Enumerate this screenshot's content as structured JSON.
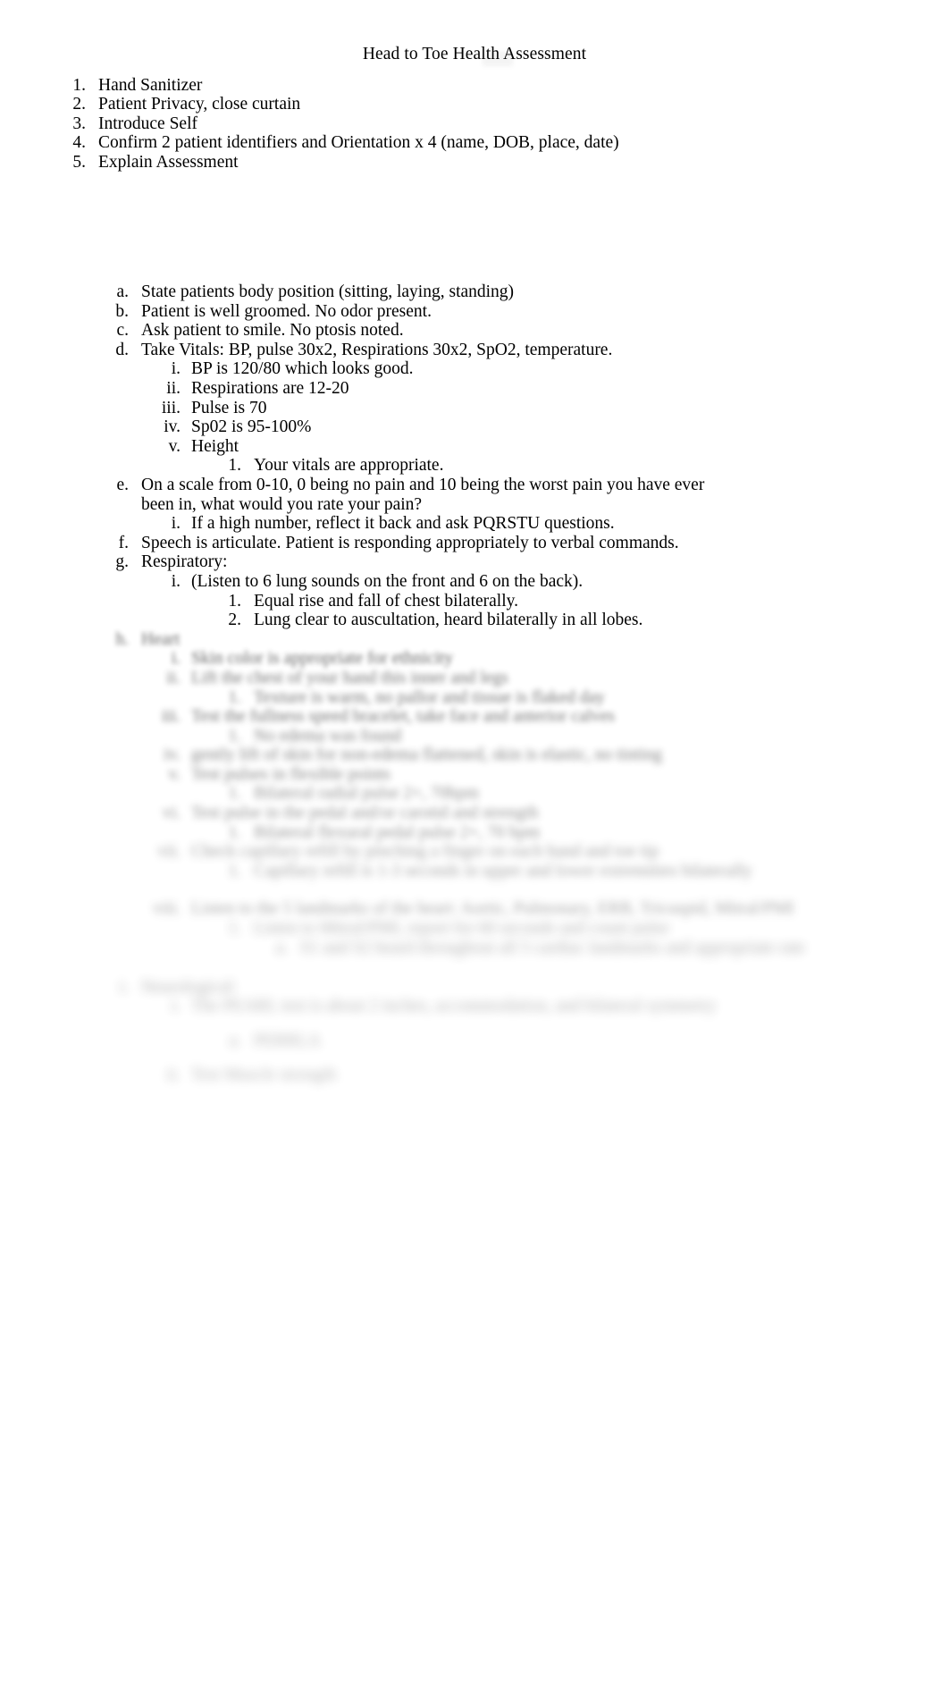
{
  "document": {
    "title": "Head to Toe Health Assessment",
    "page_background": "#ffffff",
    "text_color": "#000000"
  },
  "intro_steps": [
    {
      "marker": "1.",
      "text": "Hand Sanitizer"
    },
    {
      "marker": "2.",
      "text": "Patient Privacy, close curtain"
    },
    {
      "marker": "3.",
      "text": "Introduce Self"
    },
    {
      "marker": "4.",
      "text": "Confirm 2 patient identifiers and Orientation x 4 (name, DOB, place, date)"
    },
    {
      "marker": "5.",
      "text": "Explain Assessment"
    }
  ],
  "assessment": [
    {
      "marker": "a.",
      "text": "State patients body position (sitting, laying, standing)"
    },
    {
      "marker": "b.",
      "text": "Patient is well groomed. No odor present."
    },
    {
      "marker": "c.",
      "text": "Ask patient to smile. No ptosis noted."
    },
    {
      "marker": "d.",
      "text": "Take Vitals: BP, pulse 30x2, Respirations 30x2, SpO2, temperature."
    },
    {
      "marker": "i.",
      "text": "BP is 120/80 which looks good."
    },
    {
      "marker": "ii.",
      "text": "Respirations are 12-20"
    },
    {
      "marker": "iii.",
      "text": "Pulse is 70"
    },
    {
      "marker": "iv.",
      "text": "Sp02 is 95-100%"
    },
    {
      "marker": "v.",
      "text": "Height"
    },
    {
      "marker": "1.",
      "text": "Your vitals are appropriate."
    },
    {
      "marker": "e.",
      "text": "On a scale from 0-10, 0 being no pain and 10 being the worst pain you have ever been in, what would you rate your pain?"
    },
    {
      "marker": "i.",
      "text": "If a high number, reflect it back and ask PQRSTU questions."
    },
    {
      "marker": "f.",
      "text": "Speech is articulate. Patient is responding appropriately to verbal commands."
    },
    {
      "marker": "g.",
      "text": "Respiratory:"
    },
    {
      "marker": "i.",
      "text": "(Listen to 6 lung sounds on the front and 6 on the back)."
    },
    {
      "marker": "1.",
      "text": "Equal rise and fall of chest bilaterally."
    },
    {
      "marker": "2.",
      "text": "Lung clear to auscultation, heard bilaterally in all lobes."
    }
  ],
  "obscured_region": {
    "note": "Remaining content is blurred and illegible in the screenshot.",
    "lines": [
      {
        "marker": "h.",
        "text": "Heart"
      },
      {
        "marker": "i.",
        "text": "Skin color is appropriate for ethnicity"
      },
      {
        "marker": "ii.",
        "text": "Lift the chest of your hand this inner and legs"
      },
      {
        "marker": "1.",
        "text": "Texture is warm, no pallor and tissue is flaked day"
      },
      {
        "marker": "iii.",
        "text": "Test the fullness speed bracelet, take face and anterior calves"
      },
      {
        "marker": "1.",
        "text": "No edema was found"
      },
      {
        "marker": "iv.",
        "text": "gently lift of skin for non-edema flattened, skin is elastic, no tinting"
      },
      {
        "marker": "v.",
        "text": "Test pulses in flexible points"
      },
      {
        "marker": "1.",
        "text": "Bilateral radial pulse 2+, 70bpm"
      },
      {
        "marker": "vi.",
        "text": "Test pulse in the pedal and/or carotid and strength"
      },
      {
        "marker": "1.",
        "text": "Bilateral flexural pedal pulse 2+, 70 bpm"
      },
      {
        "marker": "vii.",
        "text": "Check capillary refill by pinching a finger on each hand and toe tip"
      },
      {
        "marker": "1.",
        "text": "Capillary refill is 1-3 seconds in upper and lower extremities bilaterally"
      },
      {
        "marker": "viii.",
        "text": "Listen to the 5 landmarks of the heart: Aortic, Pulmonary, ERB, Tricuspid, Mitral/PMI"
      },
      {
        "marker": "1.",
        "text": "Listen to Mitral/PMI, report for 60 seconds and count pulse"
      },
      {
        "marker": "a.",
        "text": "S1 and S2 heard throughout all 5 cardiac landmarks and appropriate rate"
      },
      {
        "marker": "i.",
        "text": "Neurological:"
      },
      {
        "marker": "i.",
        "text": "The PEARL test is about 2 inches, accommodation, and bilateral symmetry"
      },
      {
        "marker": "a.",
        "text": "PERRLA"
      },
      {
        "marker": "ii.",
        "text": "Test Muscle strength"
      }
    ]
  }
}
